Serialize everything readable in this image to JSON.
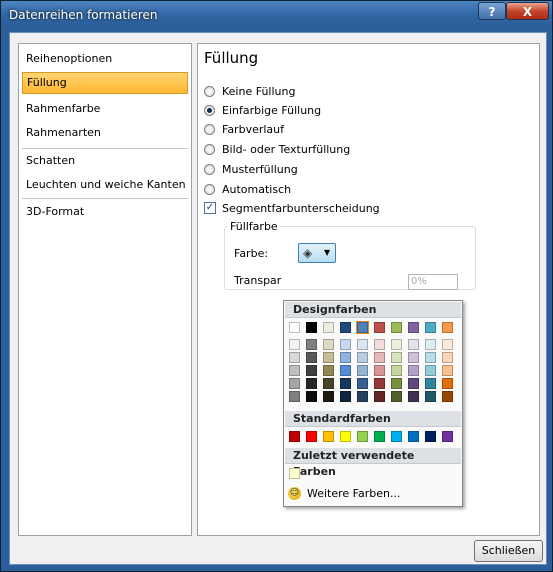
{
  "window": {
    "title": "Datenreihen formatieren",
    "help_label": "?",
    "close_label": "X"
  },
  "nav": {
    "items": [
      {
        "label": "Reihenoptionen"
      },
      {
        "label": "Füllung"
      },
      {
        "label": "Rahmenfarbe"
      },
      {
        "label": "Rahmenarten"
      },
      {
        "label": "Schatten"
      },
      {
        "label": "Leuchten und weiche Kanten"
      },
      {
        "label": "3D-Format"
      }
    ],
    "selected": "Füllung"
  },
  "panel": {
    "title": "Füllung",
    "options": [
      {
        "label": "Keine Füllung",
        "selected": false
      },
      {
        "label": "Einfarbige Füllung",
        "selected": true
      },
      {
        "label": "Farbverlauf",
        "selected": false
      },
      {
        "label": "Bild- oder Texturfüllung",
        "selected": false
      },
      {
        "label": "Musterfüllung",
        "selected": false
      },
      {
        "label": "Automatisch",
        "selected": false
      }
    ],
    "checkbox": {
      "label": "Segmentfarbunterscheidung",
      "checked": true
    },
    "group_label": "Füllfarbe",
    "farbe_label": "Farbe:",
    "transparenz_label": "Transpar",
    "transparenz_value": "0%"
  },
  "popup": {
    "design_header": "Designfarben",
    "standard_header": "Standardfarben",
    "recent_header": "Zuletzt verwendete Farben",
    "more_colors": "Weitere Farben...",
    "theme_top": [
      "#ffffff",
      "#000000",
      "#eeece1",
      "#1f497d",
      "#4f81bd",
      "#c0504d",
      "#9bbb59",
      "#8064a2",
      "#4bacc6",
      "#f79646"
    ],
    "theme_shades": [
      [
        "#f2f2f2",
        "#7f7f7f",
        "#ddd9c3",
        "#c6d9f0",
        "#dbe5f1",
        "#f2dcdb",
        "#ebf1dd",
        "#e5e0ec",
        "#dbeef3",
        "#fdeada"
      ],
      [
        "#d8d8d8",
        "#595959",
        "#c4bd97",
        "#8db3e2",
        "#b8cce4",
        "#e5b9b7",
        "#d7e3bc",
        "#ccc1d9",
        "#b7dde8",
        "#fbd5b5"
      ],
      [
        "#bfbfbf",
        "#3f3f3f",
        "#938953",
        "#548dd4",
        "#95b3d7",
        "#d99694",
        "#c3d69b",
        "#b2a2c7",
        "#92cddc",
        "#fac08f"
      ],
      [
        "#a5a5a5",
        "#262626",
        "#494429",
        "#17365d",
        "#366092",
        "#953734",
        "#76923c",
        "#5f497a",
        "#31859b",
        "#e36c09"
      ],
      [
        "#7f7f7f",
        "#0c0c0c",
        "#1d1b10",
        "#0f243e",
        "#244061",
        "#632423",
        "#4f6128",
        "#3f3151",
        "#205867",
        "#974806"
      ]
    ],
    "standard": [
      "#c00000",
      "#ff0000",
      "#ffc000",
      "#ffff00",
      "#92d050",
      "#00b050",
      "#00b0f0",
      "#0070c0",
      "#002060",
      "#7030a0"
    ],
    "recent": [
      "#ffffcc"
    ],
    "selected_color": "#4f81bd"
  },
  "footer": {
    "close_label": "Schließen"
  }
}
